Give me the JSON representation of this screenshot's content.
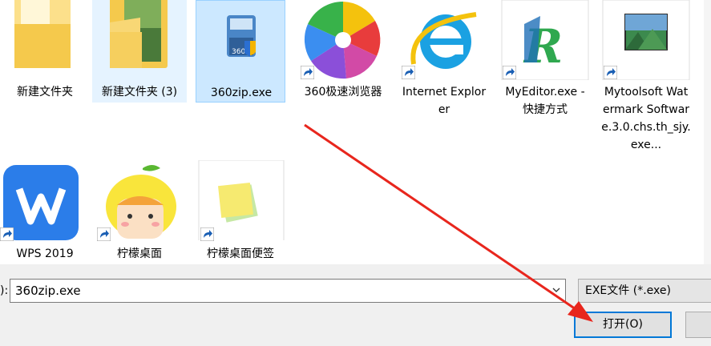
{
  "files": [
    {
      "label": "新建文件夹"
    },
    {
      "label": "新建文件夹 (3)"
    },
    {
      "label": "360zip.exe"
    },
    {
      "label": "360极速浏览器"
    },
    {
      "label": "Internet Explorer"
    },
    {
      "label": "MyEditor.exe - 快捷方式"
    },
    {
      "label": "Mytoolsoft Watermark Software.3.0.chs.th_sjy.exe..."
    },
    {
      "label": "WPS 2019"
    },
    {
      "label": "柠檬桌面"
    },
    {
      "label": "柠檬桌面便签"
    }
  ],
  "filename": {
    "label_fragment": "):",
    "value": "360zip.exe"
  },
  "filter": {
    "value": "EXE文件 (*.exe)"
  },
  "buttons": {
    "open": "打开(O)"
  },
  "colors": {
    "selection": "#cce8ff",
    "accent": "#0078d7",
    "arrow": "#e8261d"
  }
}
